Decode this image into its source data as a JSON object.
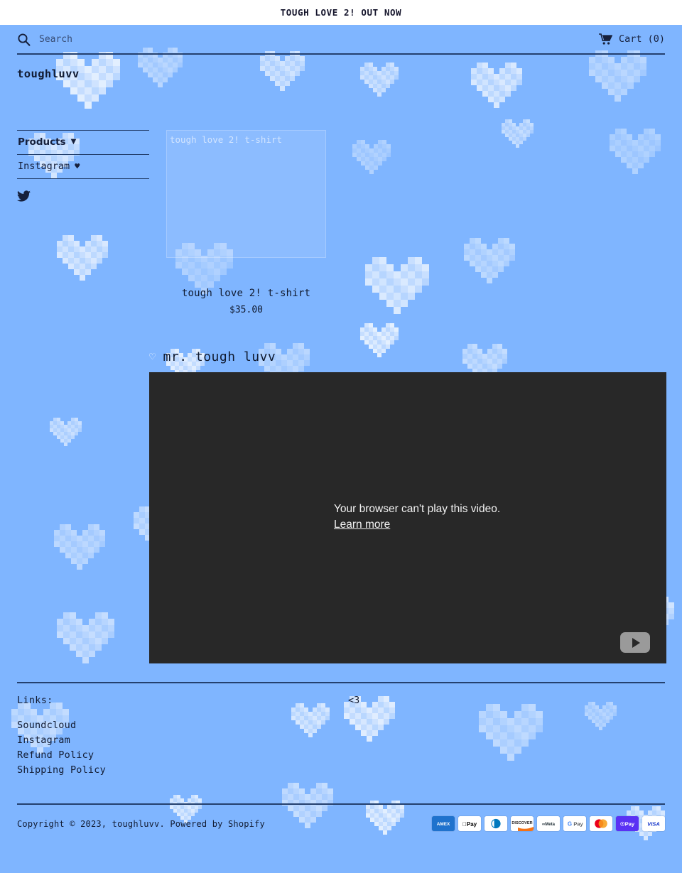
{
  "announcement": {
    "text": "TOUGH LOVE 2! OUT NOW"
  },
  "header": {
    "search": {
      "placeholder": "Search",
      "value": "",
      "icon": "search-icon"
    },
    "cart": {
      "label": "Cart (0)",
      "count": 0,
      "icon": "shopping-cart-icon"
    }
  },
  "brand": {
    "name": "toughluvv"
  },
  "sidebar": {
    "items": [
      {
        "label": "Products",
        "caret": "▼",
        "bold": true
      },
      {
        "label": "Instagram",
        "heart": "♥",
        "bold": false
      }
    ],
    "social": [
      {
        "name": "twitter-icon",
        "label": "Twitter"
      }
    ]
  },
  "products": [
    {
      "title": "tough love 2! t-shirt",
      "price": "$35.00",
      "alt_text": "tough love 2! t-shirt"
    }
  ],
  "section": {
    "heart": "♡",
    "title": "mr. tough luvv"
  },
  "video": {
    "message": "Your browser can't play this video.",
    "learn_more": "Learn more",
    "play_button": "youtube-play-icon"
  },
  "footer": {
    "links_label": "Links:",
    "heart_text": "<3",
    "links": [
      {
        "label": "Soundcloud"
      },
      {
        "label": "Instagram"
      },
      {
        "label": "Refund Policy"
      },
      {
        "label": "Shipping Policy"
      }
    ],
    "copyright": "Copyright © 2023, toughluvv. Powered by Shopify",
    "payments": [
      {
        "name": "amex",
        "label": "AMEX"
      },
      {
        "name": "apple-pay",
        "label": "Pay"
      },
      {
        "name": "diners-club",
        "label": ""
      },
      {
        "name": "discover",
        "label": "DISCOVER"
      },
      {
        "name": "meta-pay",
        "label": "Meta"
      },
      {
        "name": "google-pay",
        "label": "Pay"
      },
      {
        "name": "mastercard",
        "label": ""
      },
      {
        "name": "shop-pay",
        "label": "Pay"
      },
      {
        "name": "visa",
        "label": "VISA"
      }
    ]
  },
  "colors": {
    "background": "#7fb5ff",
    "ink": "#121c33",
    "rule": "#24406e",
    "video_bg": "#282828",
    "announce_bg": "#ffffff"
  }
}
